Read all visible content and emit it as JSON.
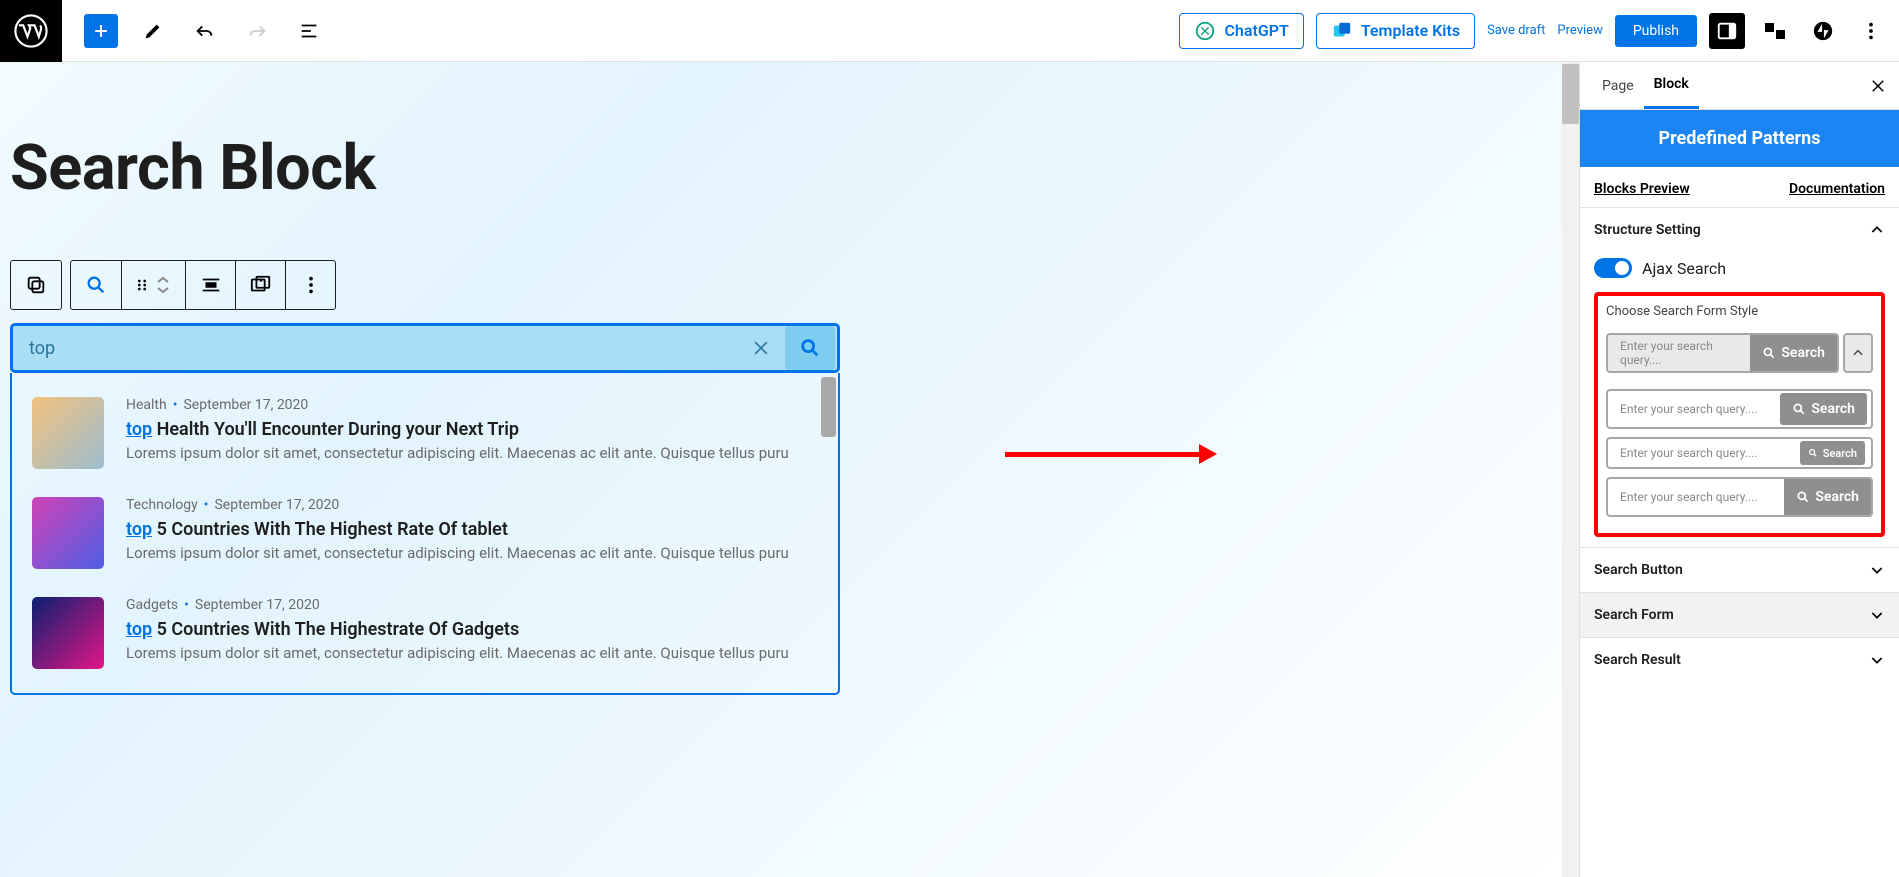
{
  "topbar": {
    "chatgpt_label": "ChatGPT",
    "template_kits_label": "Template Kits",
    "save_draft": "Save draft",
    "preview": "Preview",
    "publish": "Publish"
  },
  "page": {
    "title": "Search Block"
  },
  "search": {
    "value": "top"
  },
  "results": [
    {
      "category": "Health",
      "date": "September 17, 2020",
      "highlight": "top",
      "title_rest": " Health You'll Encounter During your Next Trip",
      "desc": "Lorems ipsum dolor sit amet, consectetur adipiscing elit. Maecenas ac elit ante. Quisque tellus puru"
    },
    {
      "category": "Technology",
      "date": "September 17, 2020",
      "highlight": "top",
      "title_rest": " 5 Countries With The Highest Rate Of tablet",
      "desc": "Lorems ipsum dolor sit amet, consectetur adipiscing elit. Maecenas ac elit ante. Quisque tellus puru"
    },
    {
      "category": "Gadgets",
      "date": "September 17, 2020",
      "highlight": "top",
      "title_rest": " 5 Countries With The Highestrate Of Gadgets",
      "desc": "Lorems ipsum dolor sit amet, consectetur adipiscing elit. Maecenas ac elit ante. Quisque tellus puru"
    }
  ],
  "sidebar": {
    "tabs": {
      "page": "Page",
      "block": "Block"
    },
    "predefined": "Predefined Patterns",
    "links": {
      "preview": "Blocks Preview",
      "docs": "Documentation"
    },
    "structure_setting": "Structure Setting",
    "ajax_search": "Ajax Search",
    "choose_style": "Choose Search Form Style",
    "placeholder": "Enter your search query....",
    "search_btn": "Search",
    "sections": {
      "search_button": "Search Button",
      "search_form": "Search Form",
      "search_result": "Search Result"
    }
  }
}
